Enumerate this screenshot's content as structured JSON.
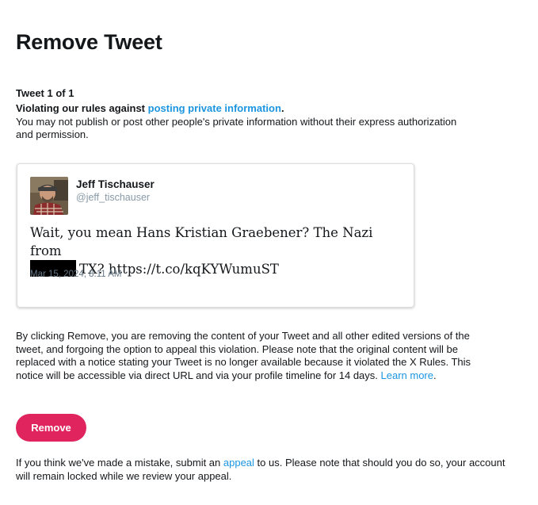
{
  "page": {
    "title": "Remove Tweet"
  },
  "violation": {
    "counter": "Tweet 1 of 1",
    "rule_prefix": "Violating our rules against ",
    "rule_link": "posting private information",
    "rule_suffix": ".",
    "rule_description": "You may not publish or post other people's private information without their express authorization and permission."
  },
  "tweet": {
    "author_name": "Jeff Tischauser",
    "author_handle": "@jeff_tischauser",
    "text_part1": "Wait, you mean Hans Kristian Graebener? The Nazi from",
    "text_part2": "TX? https://t.co/kqKYWumuST",
    "timestamp": "Mar 15, 2024, 8:11 AM"
  },
  "explanation": {
    "text": "By clicking Remove, you are removing the content of your Tweet and all other edited versions of the tweet, and forgoing the option to appeal this violation. Please note that the original content will be replaced with a notice stating your Tweet is no longer available because it violated the X Rules. This notice will be accessible via direct URL and via your profile timeline for 14 days. ",
    "learn_more": "Learn more",
    "suffix": "."
  },
  "actions": {
    "remove_label": "Remove"
  },
  "appeal": {
    "prefix": "If you think we've made a mistake, submit an ",
    "link": "appeal",
    "suffix": " to us. Please note that should you do so, your account will remain locked while we review your appeal."
  },
  "colors": {
    "link": "#1b95e0",
    "remove_button": "#e0245e",
    "handle": "#8899a6",
    "redaction": "#000000"
  },
  "icons": {
    "avatar": "profile-photo"
  }
}
